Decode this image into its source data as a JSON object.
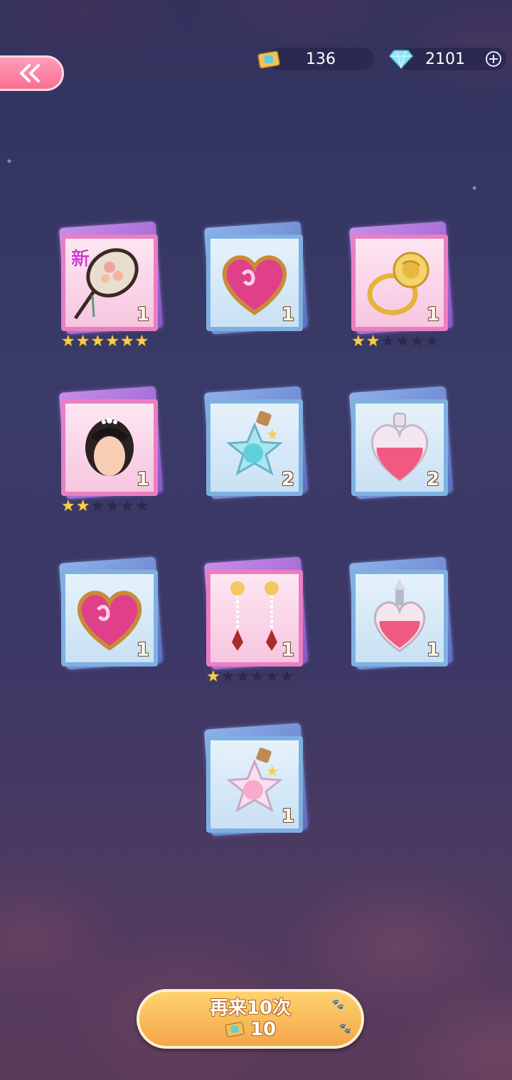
{
  "header": {
    "back_icon": "double-chevron-left-icon",
    "tickets": {
      "icon": "ticket-icon",
      "value": "136"
    },
    "diamonds": {
      "icon": "diamond-icon",
      "value": "2101",
      "add_icon": "plus-circle-icon"
    }
  },
  "colors": {
    "pink_frame": "#e97fc2",
    "blue_frame": "#7fb0e3",
    "star": "#f7cf4e",
    "button": "#f3a64a"
  },
  "rewards": [
    {
      "item": "hand-fan-icon",
      "frame": "pink",
      "qty": "1",
      "badge": "新",
      "stars": 6
    },
    {
      "item": "heart-gem-icon",
      "frame": "blue",
      "qty": "1",
      "badge": "",
      "stars": 0
    },
    {
      "item": "rose-ring-icon",
      "frame": "pink",
      "qty": "1",
      "badge": "",
      "stars": 2
    },
    {
      "item": "hairstyle-icon",
      "frame": "pink",
      "qty": "1",
      "badge": "",
      "stars": 2
    },
    {
      "item": "star-bottle-blue-icon",
      "frame": "blue",
      "qty": "2",
      "badge": "",
      "stars": 0
    },
    {
      "item": "heart-potion-icon",
      "frame": "blue",
      "qty": "2",
      "badge": "",
      "stars": 0
    },
    {
      "item": "heart-gem-icon",
      "frame": "blue",
      "qty": "1",
      "badge": "",
      "stars": 0
    },
    {
      "item": "earrings-icon",
      "frame": "pink",
      "qty": "1",
      "badge": "",
      "stars": 1
    },
    {
      "item": "perfume-bottle-icon",
      "frame": "blue",
      "qty": "1",
      "badge": "",
      "stars": 0
    },
    {
      "item": "star-bottle-pink-icon",
      "frame": "blue",
      "qty": "1",
      "badge": "",
      "stars": 0
    }
  ],
  "again_button": {
    "label": "再来10次",
    "cost_icon": "ticket-icon",
    "cost": "10"
  }
}
